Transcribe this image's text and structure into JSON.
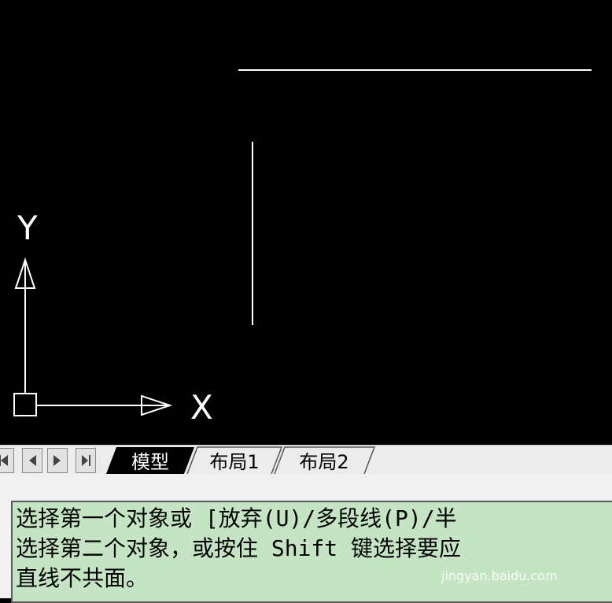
{
  "ucs_icon": {
    "y_label": "Y",
    "x_label": "X"
  },
  "tabs": {
    "nav_icons": [
      "first-icon",
      "prev-icon",
      "next-icon",
      "last-icon"
    ],
    "items": [
      {
        "label": "模型",
        "active": true
      },
      {
        "label": "布局1",
        "active": false
      },
      {
        "label": "布局2",
        "active": false
      }
    ]
  },
  "command": {
    "lines": [
      "选择第一个对象或 [放弃(U)/多段线(P)/半",
      "选择第二个对象，或按住 Shift 键选择要应",
      "直线不共面。"
    ],
    "watermark": "jingyan.baidu.com"
  },
  "colors": {
    "drawing_bg": "#000000",
    "line": "#ffffff",
    "command_bg": "#c4e4c4",
    "active_tab": "#000000"
  }
}
